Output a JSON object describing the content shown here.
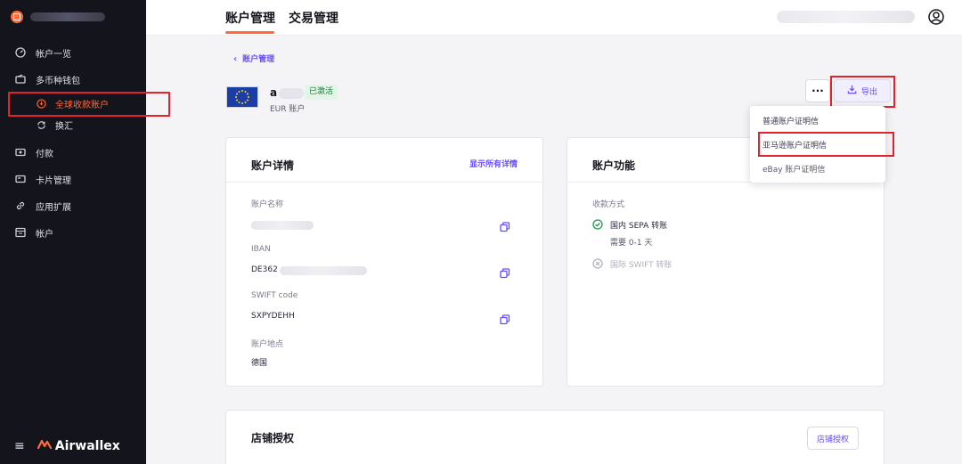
{
  "sidebar": {
    "items": [
      {
        "label": "帐户一览",
        "icon": "dashboard-icon"
      },
      {
        "label": "多币种钱包",
        "icon": "wallet-icon"
      },
      {
        "label": "全球收款账户",
        "icon": "receive-icon",
        "active": true
      },
      {
        "label": "换汇",
        "icon": "exchange-icon"
      },
      {
        "label": "付款",
        "icon": "payment-icon"
      },
      {
        "label": "卡片管理",
        "icon": "card-icon"
      },
      {
        "label": "应用扩展",
        "icon": "link-icon"
      },
      {
        "label": "帐户",
        "icon": "account-icon"
      }
    ],
    "brand_name": "Airwallex"
  },
  "header": {
    "tabs": [
      {
        "label": "账户管理",
        "active": true
      },
      {
        "label": "交易管理",
        "active": false
      }
    ]
  },
  "breadcrumb": {
    "back_label": "账户管理"
  },
  "account": {
    "name_initial": "a",
    "status": "已激活",
    "subtitle": "EUR 账户"
  },
  "actions": {
    "more_label": "···",
    "export_label": "导出"
  },
  "export_menu": {
    "items": [
      "普通账户证明信",
      "亚马逊账户证明信",
      "eBay 账户证明信"
    ]
  },
  "details_card": {
    "title": "账户详情",
    "show_all_label": "显示所有详情",
    "fields": [
      {
        "label": "账户名称",
        "value": ""
      },
      {
        "label": "IBAN",
        "value": "DE362"
      },
      {
        "label": "SWIFT code",
        "value": "SXPYDEHH"
      },
      {
        "label": "账户地点",
        "value": "德国"
      }
    ]
  },
  "features_card": {
    "title": "账户功能",
    "section_label": "收款方式",
    "methods": [
      {
        "label": "国内 SEPA 转账",
        "note": "需要 0-1 天",
        "enabled": true
      },
      {
        "label": "国际 SWIFT 转账",
        "note": "",
        "enabled": false
      }
    ]
  },
  "store_card": {
    "title": "店铺授权",
    "button_label": "店铺授权"
  },
  "colors": {
    "accent": "#6a4cff",
    "brand": "#ff6a3d",
    "highlight": "#e5222b",
    "sidebar_bg": "#14141c"
  }
}
